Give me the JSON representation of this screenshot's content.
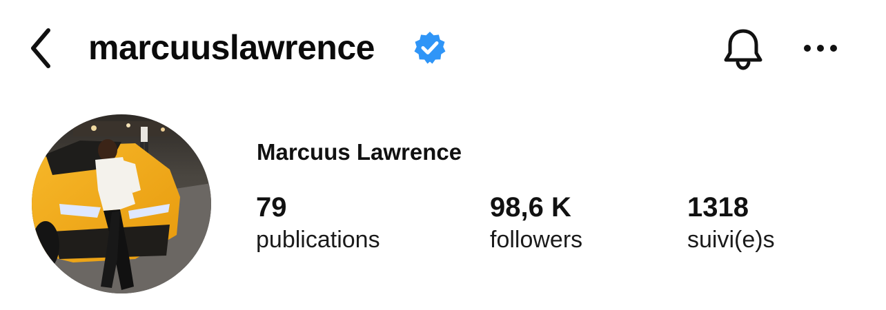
{
  "header": {
    "username": "marcuuslawrence",
    "verified_icon": "verified-badge-icon",
    "back_icon": "chevron-left-icon",
    "notification_icon": "bell-icon",
    "more_icon": "more-horizontal-icon"
  },
  "profile": {
    "display_name": "Marcuus Lawrence",
    "avatar": "profile-photo"
  },
  "stats": {
    "posts": {
      "value": "79",
      "label": "publications"
    },
    "followers": {
      "value": "98,6 K",
      "label": "followers"
    },
    "following": {
      "value": "1318",
      "label": "suivi(e)s"
    }
  },
  "colors": {
    "text": "#111111",
    "verified_blue": "#2F95F7",
    "background": "#FFFFFF"
  }
}
